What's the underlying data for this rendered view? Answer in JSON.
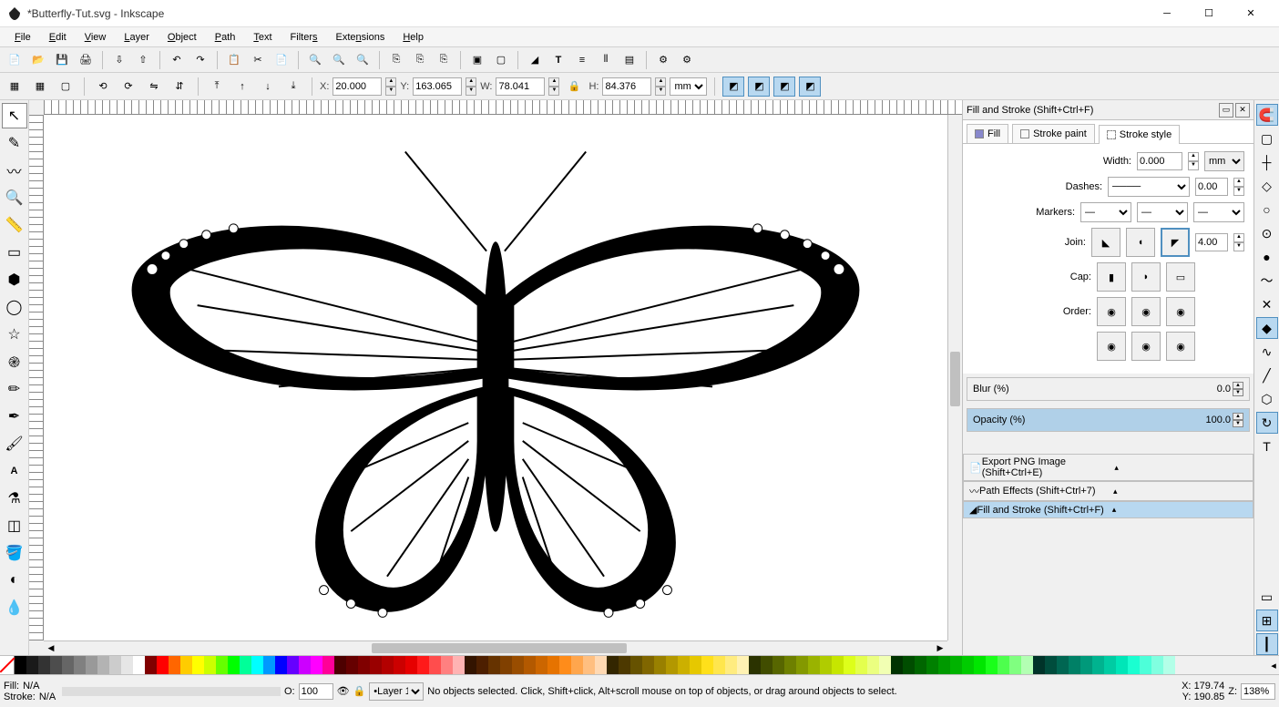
{
  "window": {
    "title": "*Butterfly-Tut.svg - Inkscape"
  },
  "menubar": [
    "File",
    "Edit",
    "View",
    "Layer",
    "Object",
    "Path",
    "Text",
    "Filters",
    "Extensions",
    "Help"
  ],
  "ctrlbar": {
    "x_label": "X:",
    "x": "20.000",
    "y_label": "Y:",
    "y": "163.065",
    "w_label": "W:",
    "w": "78.041",
    "h_label": "H:",
    "h": "84.376",
    "unit": "mm"
  },
  "dock": {
    "title": "Fill and Stroke (Shift+Ctrl+F)",
    "tabs": {
      "fill": "Fill",
      "stroke_paint": "Stroke paint",
      "stroke_style": "Stroke style"
    },
    "width_label": "Width:",
    "width": "0.000",
    "width_unit": "mm",
    "dashes_label": "Dashes:",
    "dashes_val": "0.00",
    "markers_label": "Markers:",
    "join_label": "Join:",
    "join_val": "4.00",
    "cap_label": "Cap:",
    "order_label": "Order:",
    "blur_label": "Blur (%)",
    "blur": "0.0",
    "opacity_label": "Opacity (%)",
    "opacity": "100.0",
    "export": "Export PNG Image (Shift+Ctrl+E)",
    "patheffects": "Path Effects  (Shift+Ctrl+7)",
    "fillstroke": "Fill and Stroke (Shift+Ctrl+F)"
  },
  "statusbar": {
    "fill": "Fill:",
    "fillv": "N/A",
    "stroke": "Stroke:",
    "strokev": "N/A",
    "o_label": "O:",
    "opacity": "100",
    "layer": "Layer 1",
    "msg": "No objects selected. Click, Shift+click, Alt+scroll mouse on top of objects, or drag around objects to select.",
    "x_label": "X:",
    "x": "179.74",
    "y_label": "Y:",
    "y": "190.85",
    "z_label": "Z:",
    "zoom": "138%"
  },
  "palette_colors": [
    "#000000",
    "#1a1a1a",
    "#333333",
    "#4d4d4d",
    "#666666",
    "#808080",
    "#999999",
    "#b3b3b3",
    "#cccccc",
    "#e6e6e6",
    "#ffffff",
    "#800000",
    "#ff0000",
    "#ff6600",
    "#ffcc00",
    "#ffff00",
    "#ccff00",
    "#66ff00",
    "#00ff00",
    "#00ff99",
    "#00ffff",
    "#0099ff",
    "#0000ff",
    "#6600ff",
    "#cc00ff",
    "#ff00ff",
    "#ff0099",
    "#4d0000",
    "#660000",
    "#800000",
    "#990000",
    "#b30000",
    "#cc0000",
    "#e60000",
    "#ff1a1a",
    "#ff4d4d",
    "#ff8080",
    "#ffb3b3",
    "#331400",
    "#4d1f00",
    "#663300",
    "#804000",
    "#994d00",
    "#b35900",
    "#cc6600",
    "#e67300",
    "#ff8c1a",
    "#ffa64d",
    "#ffbf80",
    "#ffd9b3",
    "#332600",
    "#4d3900",
    "#665200",
    "#806600",
    "#998000",
    "#b39800",
    "#ccb000",
    "#e6c800",
    "#ffe01a",
    "#ffe64d",
    "#ffec80",
    "#fff2b3",
    "#2b3300",
    "#414d00",
    "#576600",
    "#6e8000",
    "#849900",
    "#9ab300",
    "#b0cc00",
    "#c6e600",
    "#ddff1a",
    "#e4ff4d",
    "#ebff80",
    "#f1ffb3",
    "#003300",
    "#004d00",
    "#006600",
    "#008000",
    "#009900",
    "#00b300",
    "#00cc00",
    "#00e600",
    "#1aff1a",
    "#4dff4d",
    "#80ff80",
    "#b3ffb3",
    "#003329",
    "#004d3d",
    "#006652",
    "#008066",
    "#00997a",
    "#00b38f",
    "#00cca3",
    "#00e6b8",
    "#1affd1",
    "#4dffd9",
    "#80ffe0",
    "#b3ffe8"
  ]
}
